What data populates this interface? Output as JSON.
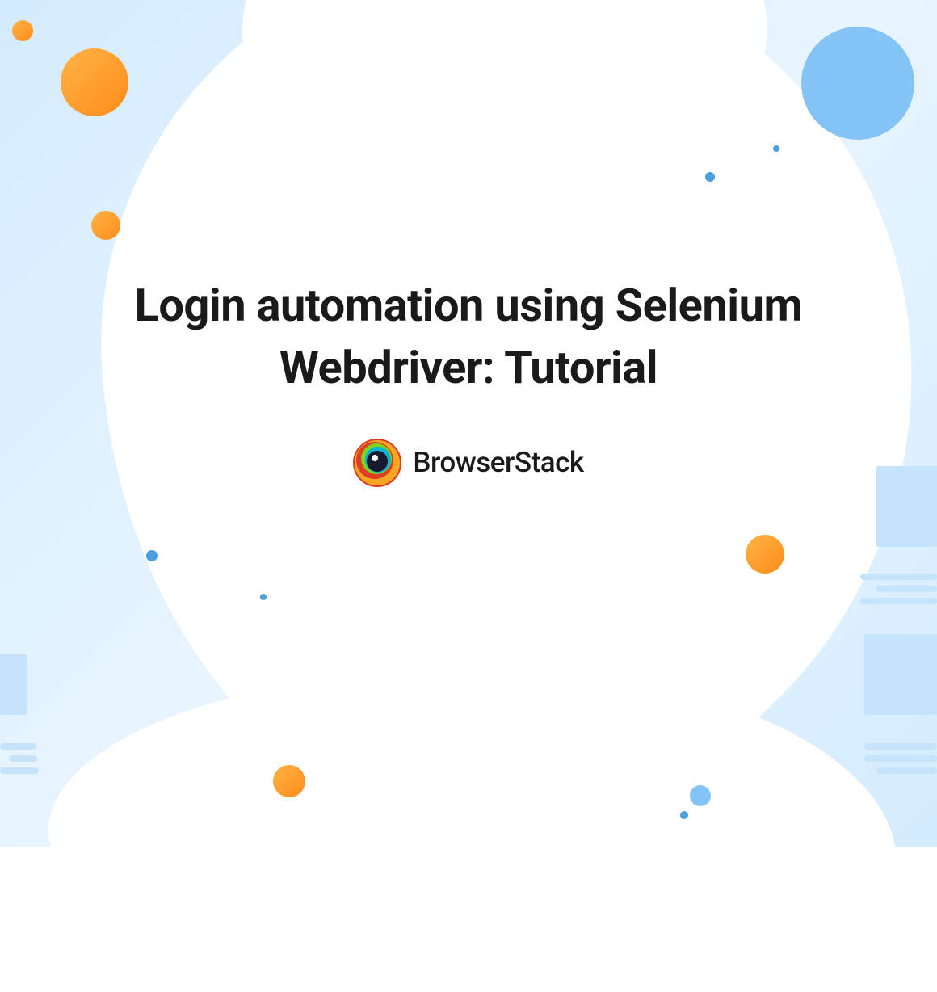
{
  "title": "Login automation using Selenium Webdriver: Tutorial",
  "brand": {
    "name": "BrowserStack"
  }
}
